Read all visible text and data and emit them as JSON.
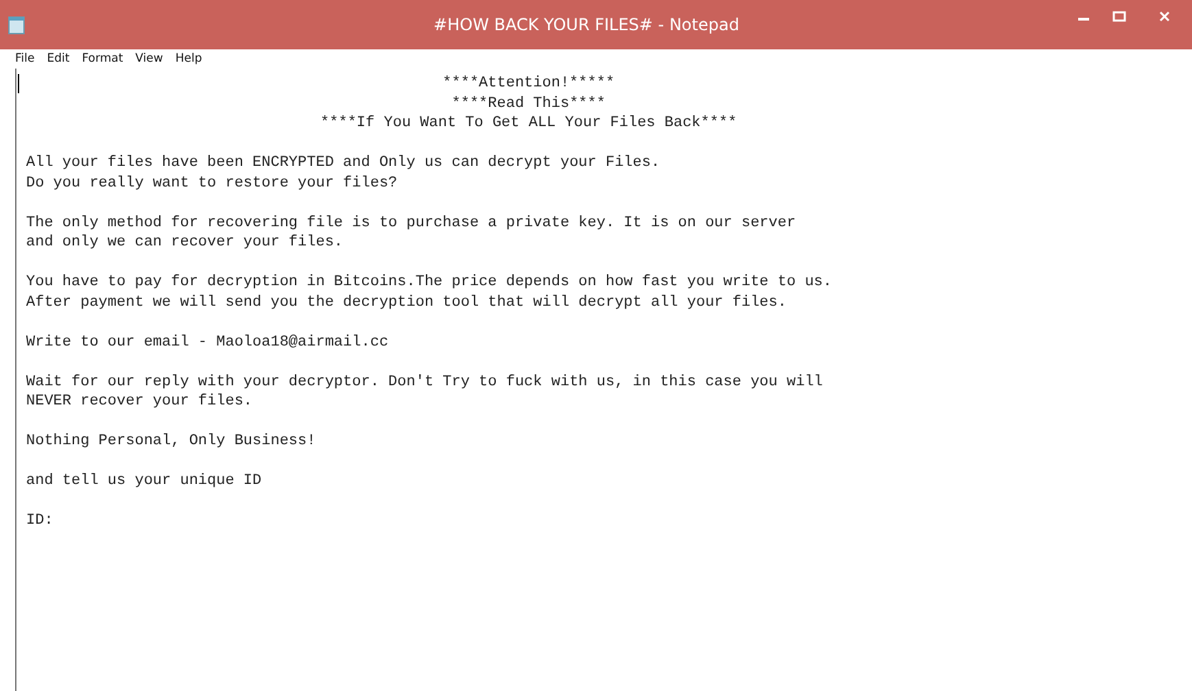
{
  "window": {
    "title": "#HOW BACK YOUR FILES# - Notepad"
  },
  "menu": [
    "File",
    "Edit",
    "Format",
    "View",
    "Help"
  ],
  "document": {
    "headings": [
      "****Attention!*****",
      "****Read This****",
      "****If You Want To Get ALL Your Files Back****"
    ],
    "paragraphs": [
      "All your files have been ENCRYPTED and Only us can decrypt your Files.\nDo you really want to restore your files?",
      "The only method for recovering file is to purchase a private key. It is on our server\nand only we can recover your files.",
      "You have to pay for decryption in Bitcoins.The price depends on how fast you write to us.\nAfter payment we will send you the decryption tool that will decrypt all your files.",
      "Write to our email - Maoloa18@airmail.cc",
      "Wait for our reply with your decryptor. Don't Try to fuck with us, in this case you will\nNEVER recover your files.",
      "Nothing Personal, Only Business!",
      "and tell us your unique ID",
      "ID:"
    ]
  }
}
